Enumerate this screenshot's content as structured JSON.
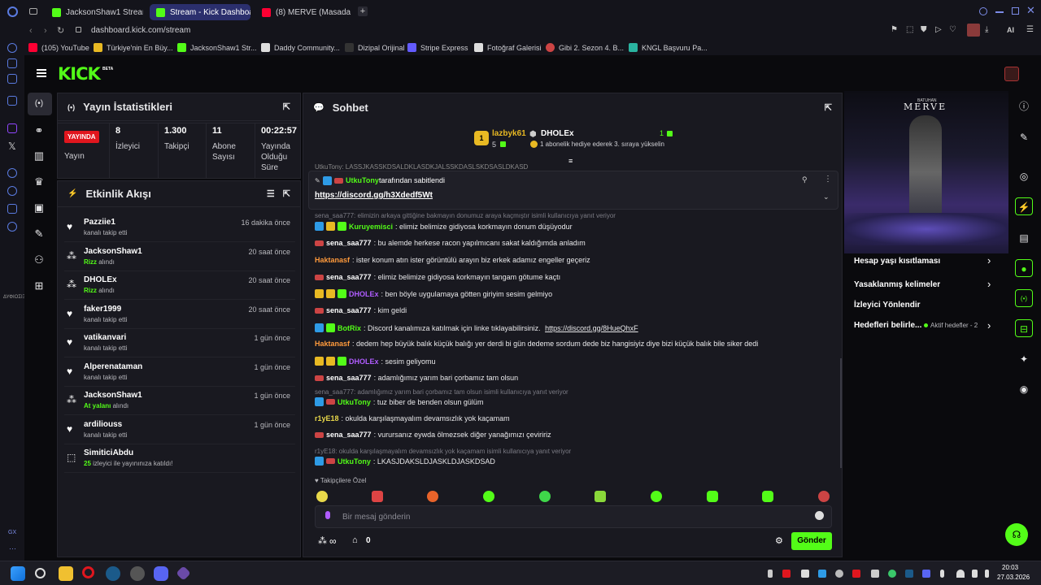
{
  "browser": {
    "tabs": [
      {
        "label": "JacksonShaw1 Stream - W",
        "color": "#53fc18"
      },
      {
        "label": "Stream - Kick Dashboard",
        "color": "#53fc18"
      },
      {
        "label": "(8) MERVE (Masada Ci",
        "color": "#ff0033"
      }
    ],
    "url": "dashboard.kick.com/stream",
    "ai_label": "AI",
    "bookmarks": [
      "(105) YouTube",
      "Türkiye'nin En Büy...",
      "JacksonShaw1 Str...",
      "Daddy Community...",
      "Dizipal Orijinal",
      "Stripe Express",
      "Fotoğraf Galerisi",
      "Gibi 2. Sezon 4. B...",
      "KNGL Başvuru Pa..."
    ]
  },
  "kick": {
    "logo": "KICK",
    "logo_badge": "BETA"
  },
  "stats": {
    "title": "Yayın İstatistikleri",
    "live_badge": "YAYINDA",
    "live_label": "Yayın",
    "viewers_value": "8",
    "viewers_label": "İzleyici",
    "followers_value": "1.300",
    "followers_label": "Takipçi",
    "subs_value": "11",
    "subs_label": "Abone Sayısı",
    "time_value": "00:22:57",
    "time_label": "Yayında Olduğu Süre"
  },
  "activity": {
    "title": "Etkinlik Akışı",
    "events": [
      {
        "name": "Pazziie1",
        "desc_pre": "",
        "desc_hl": "",
        "desc_post": "kanalı takip etti",
        "time": "16 dakika önce",
        "icon": "heart"
      },
      {
        "name": "JacksonShaw1",
        "desc_pre": "",
        "desc_hl": "Rizz",
        "desc_post": " alındı",
        "time": "20 saat önce",
        "icon": "points"
      },
      {
        "name": "DHOLEx",
        "desc_pre": "",
        "desc_hl": "Rizz",
        "desc_post": " alındı",
        "time": "20 saat önce",
        "icon": "points"
      },
      {
        "name": "faker1999",
        "desc_pre": "",
        "desc_hl": "",
        "desc_post": "kanalı takip etti",
        "time": "20 saat önce",
        "icon": "heart"
      },
      {
        "name": "vatikanvari",
        "desc_pre": "",
        "desc_hl": "",
        "desc_post": "kanalı takip etti",
        "time": "1 gün önce",
        "icon": "heart"
      },
      {
        "name": "Alperenataman",
        "desc_pre": "",
        "desc_hl": "",
        "desc_post": "kanalı takip etti",
        "time": "1 gün önce",
        "icon": "heart"
      },
      {
        "name": "JacksonShaw1",
        "desc_pre": "",
        "desc_hl": "At yalanı",
        "desc_post": " alındı",
        "time": "1 gün önce",
        "icon": "points"
      },
      {
        "name": "ardiliouss",
        "desc_pre": "",
        "desc_hl": "",
        "desc_post": "kanalı takip etti",
        "time": "1 gün önce",
        "icon": "heart"
      },
      {
        "name": "SimiticiAbdu",
        "desc_pre": "",
        "desc_hl": "25",
        "desc_post": " izleyici ile yayınınıza katıldı!",
        "time": "",
        "icon": "raid"
      }
    ]
  },
  "chat": {
    "title": "Sohbet",
    "top_rank": "1",
    "top_name": "lazbyk61",
    "top_count": "5",
    "top2_name": "DHOLEx",
    "top2_count": "1",
    "top2_desc": "1 abonelik hediye ederek 3. sıraya yükselin",
    "truncated": "UtkuTony: LASSJKASSKDSALDKLASDKJALSSKDASLSKDSASLDKASD",
    "pinned_by_name": "UtkuTony",
    "pinned_by_text": "tarafından sabitlendi",
    "pinned_link": "https://discord.gg/h3Xdedf5Wt",
    "reply1": "sena_saa777: elimizin arkaya gittiğine bakmayın donumuz araya kaçmıştır isimli kullanıcıya yanıt veriyor",
    "messages": [
      {
        "user": "Kuruyemisci",
        "color": "#53fc18",
        "text": ": elimiz belimize gidiyosa korkmayın donum düşüyodur"
      },
      {
        "user": "sena_saa777",
        "color": "#ffffff",
        "text": ": bu alemde herkese racon yapılmıcanı sakat kaldığımda anladım"
      },
      {
        "user": "Haktanasf",
        "color": "#ff9a3c",
        "text": ": ister konum atın ister görüntülü arayın biz erkek adamız engeller geçeriz"
      },
      {
        "user": "sena_saa777",
        "color": "#ffffff",
        "text": ": elimiz belimize gidiyosa korkmayın tangam götume kaçtı"
      },
      {
        "user": "DHOLEx",
        "color": "#b05cff",
        "text": ": ben böyle uygulamaya götten giriyim sesim gelmiyo"
      },
      {
        "user": "sena_saa777",
        "color": "#ffffff",
        "text": ": kim geldi"
      },
      {
        "user": "BotRix",
        "color": "#53fc18",
        "text": ": Discord kanalımıza katılmak için linke tıklayabilirsiniz. ",
        "link": "https://discord.gg/8HueQhxF"
      },
      {
        "user": "Haktanasf",
        "color": "#ff9a3c",
        "text": ": dedem hep büyük balık küçük balığı yer derdi bi gün dedeme sordum dede biz hangisiyiz diye bizi küçük balık bile siker dedi"
      },
      {
        "user": "DHOLEx",
        "color": "#b05cff",
        "text": ": sesim geliyomu"
      },
      {
        "user": "sena_saa777",
        "color": "#ffffff",
        "text": ": adamlığımız yarım bari çorbamız tam olsun"
      }
    ],
    "reply2": "sena_saa777: adamlığımız yarım bari çorbamız tam olsun isimli kullanıcıya yanıt veriyor",
    "msg_utku1_user": "UtkuTony",
    "msg_utku1_text": ": tuz biber de benden olsun gülüm",
    "msg_r1_user": "r1yE18",
    "msg_r1_text": ": okulda karşılaşmayalım devamsızlık yok kaçamam",
    "msg_sena_user": "sena_saa777",
    "msg_sena_text": ": vurursanız eywda ölmezsek diğer yanağımızı çeviririz",
    "reply3": "r1yE18: okulda karşılaşmayalım devamsızlık yok kaçamam isimli kullanıcıya yanıt veriyor",
    "msg_utku2_user": "UtkuTony",
    "msg_utku2_text": ": LKASJDAKSLDJASKLDJASKDSAD",
    "followers_only": "Takipçilere Özel",
    "input_placeholder": "Bir mesaj gönderin",
    "points_symbol": "∞",
    "shop_count": "0",
    "send_label": "Gönder"
  },
  "right": {
    "video_title": "MERVE",
    "video_subtitle": "BATUHAN",
    "items": [
      "Hesap yaşı kısıtlaması",
      "Yasaklanmış kelimeler",
      "İzleyici Yönlendir",
      "Hedefleri belirle..."
    ],
    "goal_status": "Aktif hedefler - 2"
  },
  "taskbar": {
    "time": "20:03",
    "date": "27.03.2026"
  },
  "left_tags": {
    "tag1": "ΔΥΦΙΟΣΙΞ",
    "tag2": "GX"
  }
}
